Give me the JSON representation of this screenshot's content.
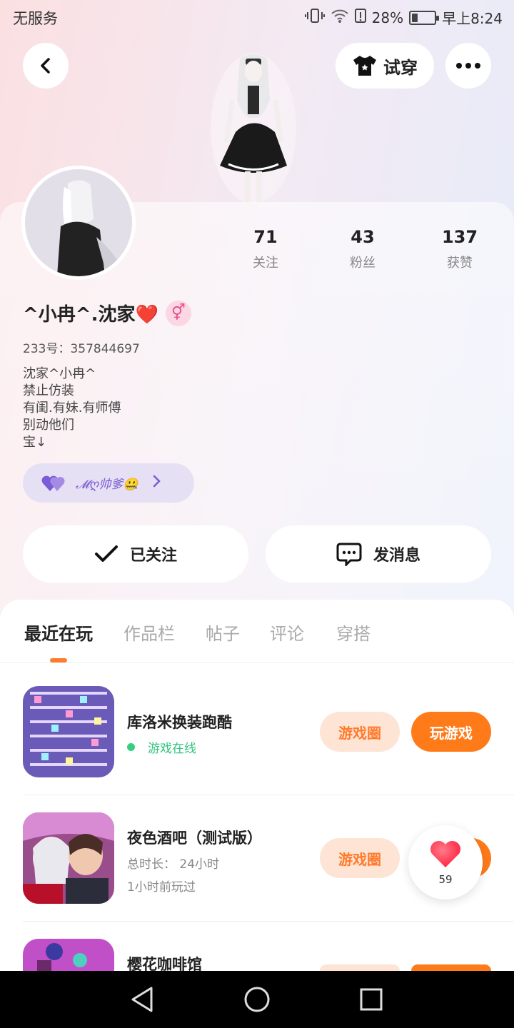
{
  "status_bar": {
    "left_text": "无服务",
    "battery": "28%",
    "battery_level": 0.28,
    "time": "早上8:24"
  },
  "header": {
    "tryon_label": "试穿"
  },
  "stats": [
    {
      "value": "71",
      "label": "关注"
    },
    {
      "value": "43",
      "label": "粉丝"
    },
    {
      "value": "137",
      "label": "获赞"
    }
  ],
  "profile": {
    "username": "^小冉^.沈家❤️",
    "gender_symbol": "⚥",
    "id_line": "233号：357844697",
    "bio": [
      "沈家^小冉^",
      "禁止仿装",
      "有闺.有妹.有师傅",
      "别动他们",
      "宝↓"
    ],
    "couple_text": "𝓜ღ帅爹🤐"
  },
  "actions": {
    "followed_label": "已关注",
    "message_label": "发消息"
  },
  "tabs": [
    "最近在玩",
    "作品栏",
    "帖子",
    "评论",
    "穿搭"
  ],
  "games": [
    {
      "title": "库洛米换装跑酷",
      "status": "游戏在线",
      "circle_label": "游戏圈",
      "play_label": "玩游戏"
    },
    {
      "title": "夜色酒吧（测试版）",
      "duration": "总时长： 24小时",
      "last_played": "1小时前玩过",
      "circle_label": "游戏圈"
    },
    {
      "title": "樱花咖啡馆"
    }
  ],
  "like_float": {
    "count": "59"
  },
  "colors": {
    "accent": "#ff7a19",
    "accent_light": "#fde4d4",
    "online": "#2fc27c",
    "chip_bg": "#e6e0f4"
  }
}
